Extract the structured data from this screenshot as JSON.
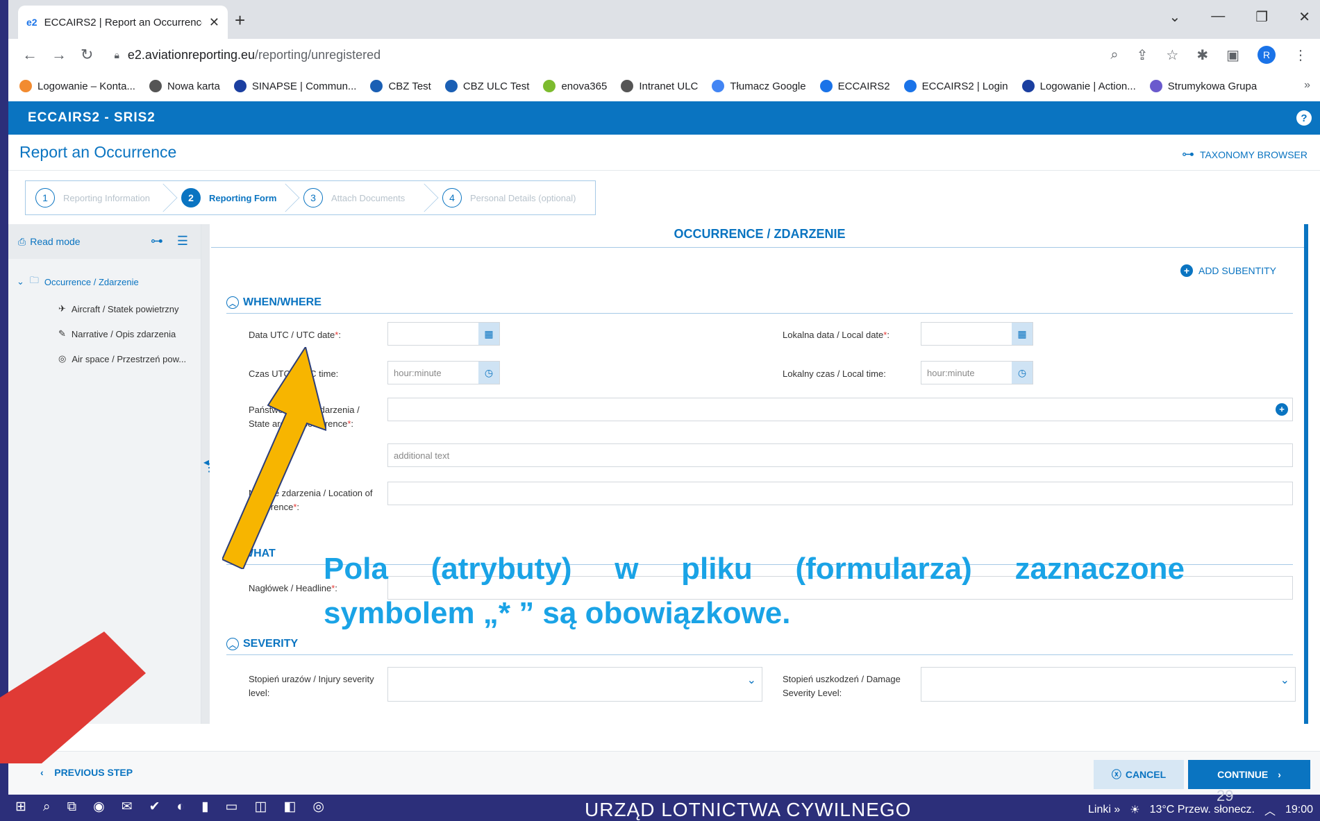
{
  "browser": {
    "tab_title": "ECCAIRS2 | Report an Occurrence",
    "new_tab": "+",
    "url_host": "e2.aviationreporting.eu",
    "url_path": "/reporting/unregistered",
    "avatar_letter": "R",
    "bookmarks": [
      {
        "label": "Logowanie – Konta...",
        "color": "#f28b30"
      },
      {
        "label": "Nowa karta",
        "color": "#555555"
      },
      {
        "label": "SINAPSE | Commun...",
        "color": "#1b3fa0"
      },
      {
        "label": "CBZ Test",
        "color": "#1a5fb4"
      },
      {
        "label": "CBZ ULC Test",
        "color": "#1a5fb4"
      },
      {
        "label": "enova365",
        "color": "#7cbb2e"
      },
      {
        "label": "Intranet ULC",
        "color": "#555555"
      },
      {
        "label": "Tłumacz Google",
        "color": "#4285f4"
      },
      {
        "label": "ECCAIRS2",
        "color": "#1a73e8"
      },
      {
        "label": "ECCAIRS2 | Login",
        "color": "#1a73e8"
      },
      {
        "label": "Logowanie | Action...",
        "color": "#1b3fa0"
      },
      {
        "label": "Strumykowa Grupa",
        "color": "#6a5acd"
      }
    ]
  },
  "app": {
    "logo": "ECCAIRS2 - SRIS2",
    "help": "?",
    "page_title": "Report an Occurrence",
    "taxonomy_browser": "TAXONOMY BROWSER",
    "steps": [
      {
        "num": "1",
        "label": "Reporting Information"
      },
      {
        "num": "2",
        "label": "Reporting Form"
      },
      {
        "num": "3",
        "label": "Attach Documents"
      },
      {
        "num": "4",
        "label": "Personal Details (optional)"
      }
    ],
    "sidebar": {
      "read_mode": "Read mode",
      "root": "Occurrence / Zdarzenie",
      "children": [
        "Aircraft / Statek powietrzny",
        "Narrative / Opis zdarzenia",
        "Air space / Przestrzeń pow..."
      ]
    },
    "form": {
      "section_title": "OCCURRENCE / ZDARZENIE",
      "add_subentity": "ADD SUBENTITY",
      "group_when_where": "WHEN/WHERE",
      "utc_date_label": "Data UTC / UTC date",
      "local_date_label": "Lokalna data / Local date",
      "utc_time_label": "Czas UTC / UTC time:",
      "local_time_label": "Lokalny czas / Local time:",
      "time_placeholder": "hour:minute",
      "state_label": "Państwo obszar zdarzenia / State area of occurrence",
      "additional_placeholder": "additional text",
      "location_label": "Miejsce zdarzenia / Location of occurrence",
      "group_what": "WHAT",
      "headline_label": "Nagłówek / Headline",
      "group_severity": "SEVERITY",
      "injury_label": "Stopień urazów / Injury severity level:",
      "damage_label": "Stopień uszkodzeń / Damage Severity Level:",
      "req_mark": "*",
      "colon": ":"
    },
    "footer": {
      "previous": "PREVIOUS STEP",
      "cancel": "CANCEL",
      "continue": "CONTINUE"
    }
  },
  "annotation": {
    "line1_words": [
      "Pola",
      "(atrybuty)",
      "w",
      "pliku",
      "(formularza)",
      "zaznaczone"
    ],
    "line2": "symbolem „* ” są obowiązkowe."
  },
  "taskbar": {
    "title": "URZĄD LOTNICTWA CYWILNEGO",
    "links": "Linki",
    "weather": "13°C  Przew. słonecz.",
    "time": "19:00",
    "page_number": "29"
  },
  "colors": {
    "brand": "#0a74c1",
    "annotation": "#1aa3e6",
    "arrow": "#f7b500",
    "slide_bg": "#2c2f7a",
    "red_accent": "#e03a35"
  }
}
